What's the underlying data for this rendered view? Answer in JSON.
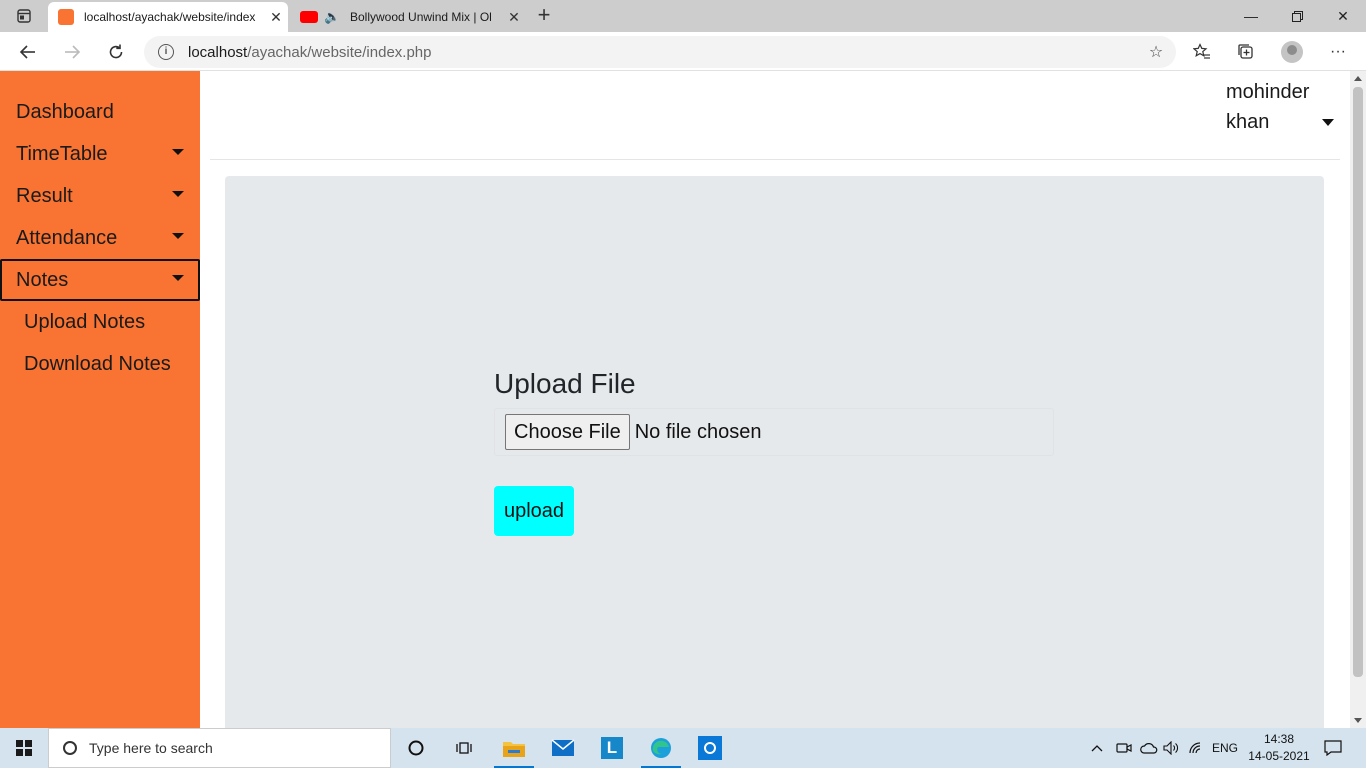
{
  "browser": {
    "tabs": [
      {
        "title": "localhost/ayachak/website/index",
        "active": true,
        "favicon": "xampp-icon",
        "favicon_color": "#f97432"
      },
      {
        "title": "Bollywood Unwind Mix | Ol",
        "active": false,
        "favicon": "youtube-icon",
        "favicon_color": "#ff0000"
      }
    ],
    "url_host": "localhost",
    "url_path": "/ayachak/website/index.php"
  },
  "sidebar": {
    "color": "#f97432",
    "items": [
      {
        "label": "Dashboard",
        "has_caret": false
      },
      {
        "label": "TimeTable",
        "has_caret": true
      },
      {
        "label": "Result",
        "has_caret": true
      },
      {
        "label": "Attendance",
        "has_caret": true
      },
      {
        "label": "Notes",
        "has_caret": true,
        "selected": true
      }
    ],
    "subitems": [
      {
        "label": "Upload Notes"
      },
      {
        "label": "Download Notes"
      }
    ]
  },
  "header": {
    "user_first": "mohinder",
    "user_last": "khan"
  },
  "form": {
    "title": "Upload File",
    "choose_label": "Choose File",
    "file_status": "No file chosen",
    "upload_label": "upload",
    "upload_color": "#00ffff"
  },
  "taskbar": {
    "search_placeholder": "Type here to search",
    "language": "ENG",
    "time": "14:38",
    "date": "14-05-2021"
  }
}
